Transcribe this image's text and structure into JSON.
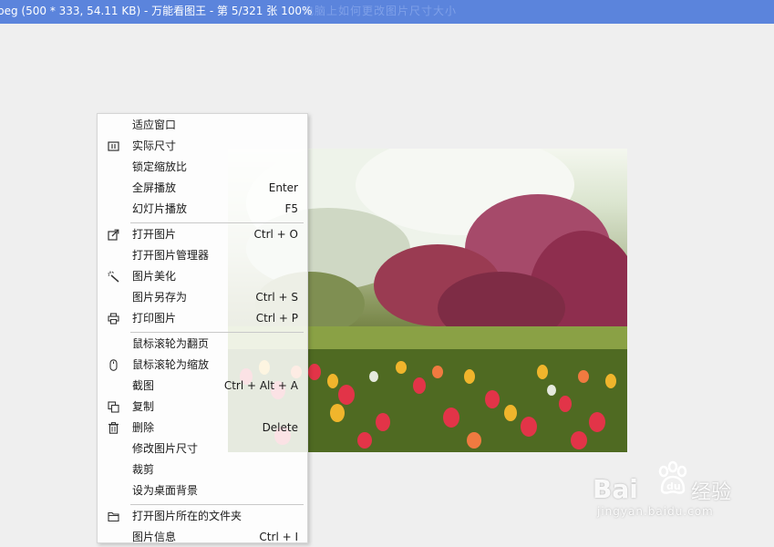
{
  "window": {
    "title": "peg (500 * 333, 54.11 KB) - 万能看图王 - 第 5/321 张 100%",
    "title_ghost_text": "电脑上如何更改图片尺寸大小"
  },
  "context_menu": {
    "items": [
      {
        "label": "适应窗口",
        "shortcut": "",
        "icon": ""
      },
      {
        "label": "实际尺寸",
        "shortcut": "",
        "icon": "actual-size-icon"
      },
      {
        "label": "锁定缩放比",
        "shortcut": "",
        "icon": ""
      },
      {
        "label": "全屏播放",
        "shortcut": "Enter",
        "icon": ""
      },
      {
        "label": "幻灯片播放",
        "shortcut": "F5",
        "icon": ""
      },
      {
        "label": "打开图片",
        "shortcut": "Ctrl + O",
        "icon": "open-external-icon"
      },
      {
        "label": "打开图片管理器",
        "shortcut": "",
        "icon": ""
      },
      {
        "label": "图片美化",
        "shortcut": "",
        "icon": "magic-wand-icon"
      },
      {
        "label": "图片另存为",
        "shortcut": "Ctrl + S",
        "icon": ""
      },
      {
        "label": "打印图片",
        "shortcut": "Ctrl + P",
        "icon": "printer-icon"
      },
      {
        "label": "鼠标滚轮为翻页",
        "shortcut": "",
        "icon": ""
      },
      {
        "label": "鼠标滚轮为缩放",
        "shortcut": "",
        "icon": "mouse-icon"
      },
      {
        "label": "截图",
        "shortcut": "Ctrl + Alt + A",
        "icon": ""
      },
      {
        "label": "复制",
        "shortcut": "",
        "icon": "copy-icon"
      },
      {
        "label": "删除",
        "shortcut": "Delete",
        "icon": "trash-icon"
      },
      {
        "label": "修改图片尺寸",
        "shortcut": "",
        "icon": ""
      },
      {
        "label": "裁剪",
        "shortcut": "",
        "icon": ""
      },
      {
        "label": "设为桌面背景",
        "shortcut": "",
        "icon": ""
      },
      {
        "label": "打开图片所在的文件夹",
        "shortcut": "",
        "icon": "folder-icon"
      },
      {
        "label": "图片信息",
        "shortcut": "Ctrl + I",
        "icon": ""
      }
    ]
  },
  "watermark": {
    "brand": "Bai",
    "brand_suffix": "经验",
    "sub": "jingyan.baidu.com"
  },
  "colors": {
    "titlebar": "#5b84dc",
    "background": "#efefef",
    "menu_background": "#ffffff"
  }
}
